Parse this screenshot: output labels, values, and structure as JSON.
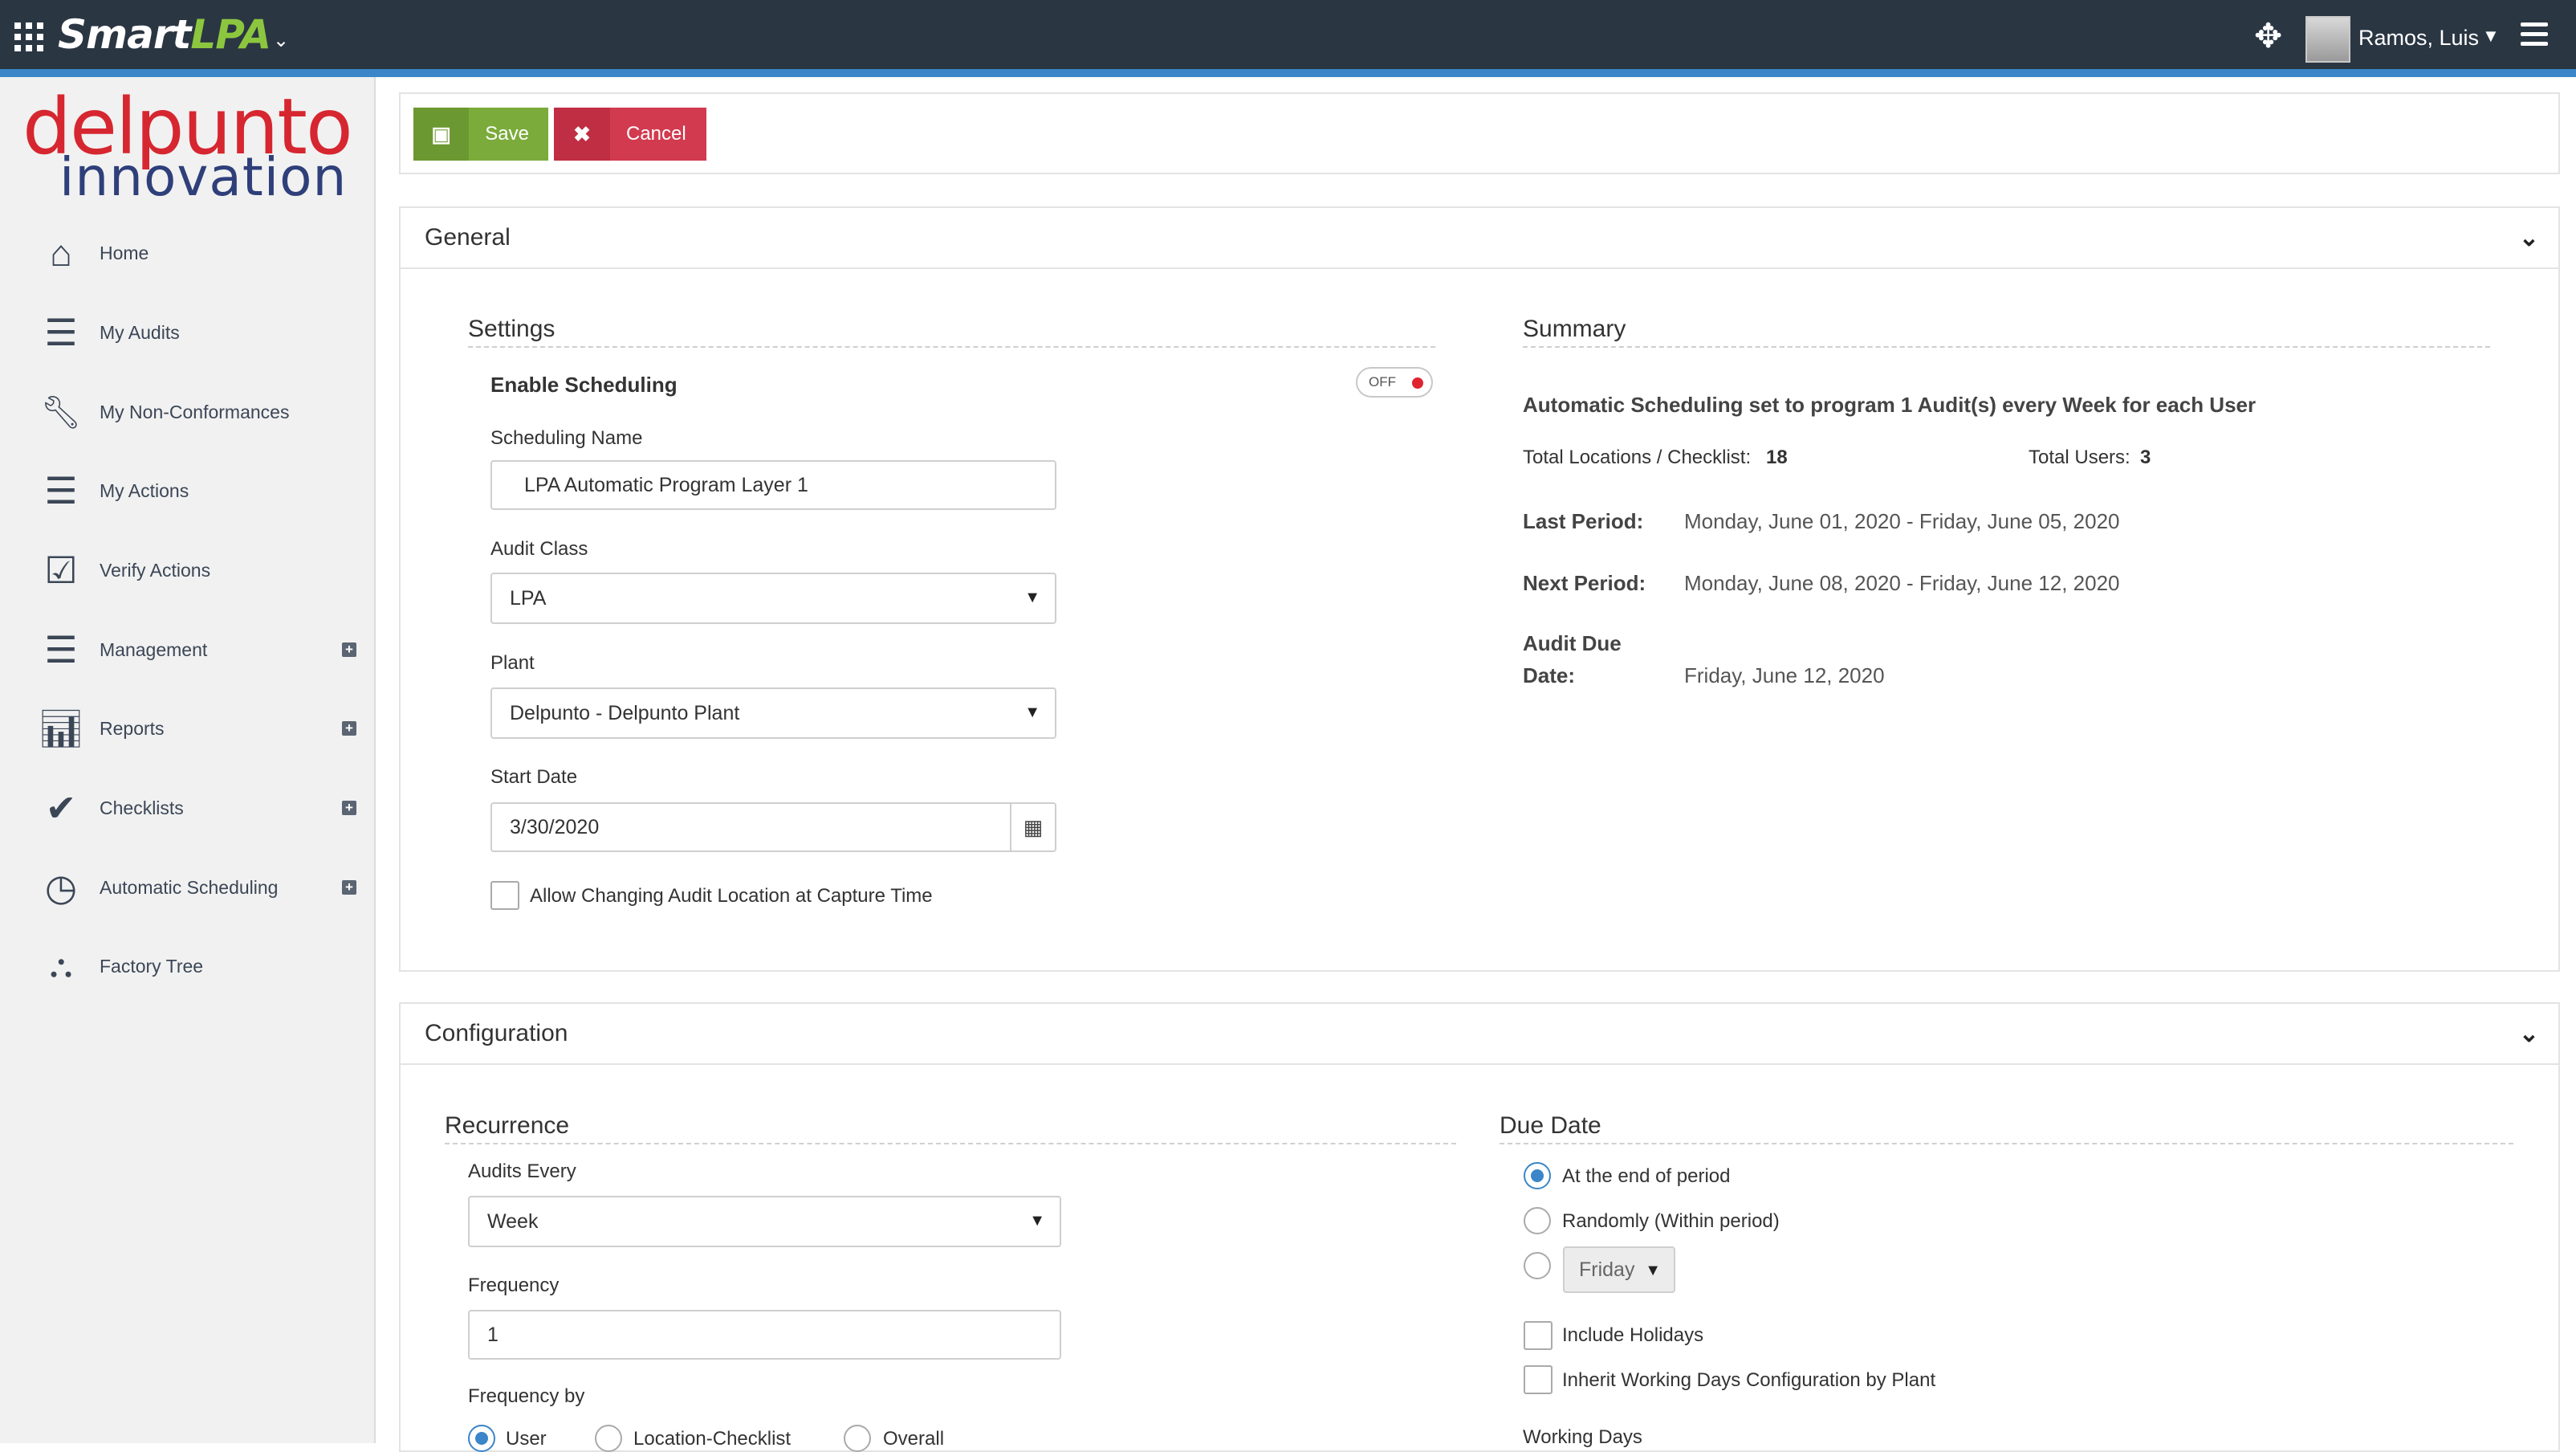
{
  "topbar": {
    "brand_smart": "Smart",
    "brand_lpa": "LPA",
    "user_name": "Ramos, Luis",
    "icons": {
      "apps": "apps-grid-icon",
      "move": "move-arrows-icon",
      "menu": "hamburger-icon"
    }
  },
  "logo": {
    "line1": "delpunto",
    "line2": "innovation"
  },
  "sidebar": {
    "items": [
      {
        "label": "Home",
        "icon": "home-icon",
        "expandable": false
      },
      {
        "label": "My Audits",
        "icon": "list-icon",
        "expandable": false
      },
      {
        "label": "My Non-Conformances",
        "icon": "wrench-icon",
        "expandable": false
      },
      {
        "label": "My Actions",
        "icon": "list-icon",
        "expandable": false
      },
      {
        "label": "Verify Actions",
        "icon": "checkbox-icon",
        "expandable": false
      },
      {
        "label": "Management",
        "icon": "list-icon",
        "expandable": true
      },
      {
        "label": "Reports",
        "icon": "bar-chart-icon",
        "expandable": true
      },
      {
        "label": "Checklists",
        "icon": "check-icon",
        "expandable": true
      },
      {
        "label": "Automatic Scheduling",
        "icon": "clock-icon",
        "expandable": true
      },
      {
        "label": "Factory Tree",
        "icon": "sitemap-icon",
        "expandable": false
      }
    ]
  },
  "toolbar": {
    "save_label": "Save",
    "cancel_label": "Cancel"
  },
  "general": {
    "title": "General",
    "settings": {
      "title": "Settings",
      "enable_scheduling_label": "Enable Scheduling",
      "toggle_state": "OFF",
      "scheduling_name_label": "Scheduling Name",
      "scheduling_name_value": "LPA Automatic Program Layer 1",
      "audit_class_label": "Audit Class",
      "audit_class_value": "LPA",
      "plant_label": "Plant",
      "plant_value": "Delpunto - Delpunto Plant",
      "start_date_label": "Start Date",
      "start_date_value": "3/30/2020",
      "allow_changing_label": "Allow Changing Audit Location at Capture Time"
    },
    "summary": {
      "title": "Summary",
      "headline": "Automatic Scheduling set to program 1 Audit(s) every Week for each User",
      "total_locations_label": "Total Locations / Checklist:",
      "total_locations_value": "18",
      "total_users_label": "Total Users:",
      "total_users_value": "3",
      "last_period_label": "Last Period:",
      "last_period_value": "Monday, June 01, 2020 - Friday, June 05, 2020",
      "next_period_label": "Next Period:",
      "next_period_value": "Monday, June 08, 2020 - Friday, June 12, 2020",
      "audit_due_label_1": "Audit Due",
      "audit_due_label_2": "Date:",
      "audit_due_value": "Friday, June 12, 2020"
    }
  },
  "configuration": {
    "title": "Configuration",
    "recurrence": {
      "title": "Recurrence",
      "audits_every_label": "Audits Every",
      "audits_every_value": "Week",
      "frequency_label": "Frequency",
      "frequency_value": "1",
      "frequency_by_label": "Frequency by",
      "frequency_by_options": [
        "User",
        "Location-Checklist",
        "Overall"
      ],
      "frequency_by_selected": "User"
    },
    "due_date": {
      "title": "Due Date",
      "options": [
        "At the end of period",
        "Randomly (Within period)"
      ],
      "selected": "At the end of period",
      "day_value": "Friday",
      "include_holidays_label": "Include Holidays",
      "inherit_label": "Inherit Working Days Configuration by Plant",
      "working_days_label": "Working Days"
    }
  }
}
